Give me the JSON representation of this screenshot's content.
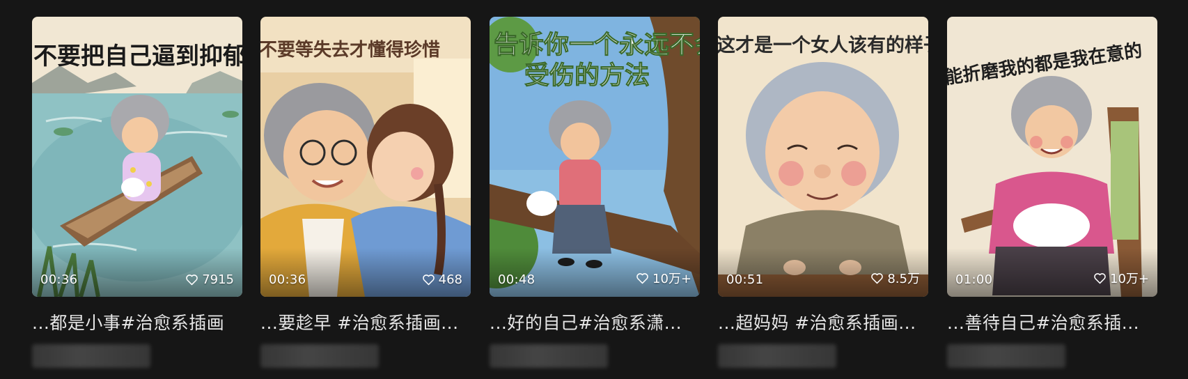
{
  "cards": [
    {
      "image_caption": "不要把自己逼到抑郁",
      "duration": "00:36",
      "likes": "7915",
      "title": "...都是小事#治愈系插画"
    },
    {
      "image_caption": "不要等失去才懂得珍惜",
      "duration": "00:36",
      "likes": "468",
      "title": "...要趁早 #治愈系插画..."
    },
    {
      "image_caption": "告诉你一个永远不会",
      "image_caption_2": "受伤的方法",
      "duration": "00:48",
      "likes": "10万+",
      "title": "...好的自己#治愈系潇..."
    },
    {
      "image_caption": "这才是一个女人该有的样子",
      "duration": "00:51",
      "likes": "8.5万",
      "title": "...超妈妈 #治愈系插画..."
    },
    {
      "image_caption": "能折磨我的都是我在意的",
      "duration": "01:00",
      "likes": "10万+",
      "title": "...善待自己#治愈系插..."
    }
  ],
  "icons": {
    "like": "heart-outline-icon"
  },
  "colors": {
    "background": "#161616",
    "title_text": "#e6e6e6",
    "overlay_text": "#ffffff"
  }
}
